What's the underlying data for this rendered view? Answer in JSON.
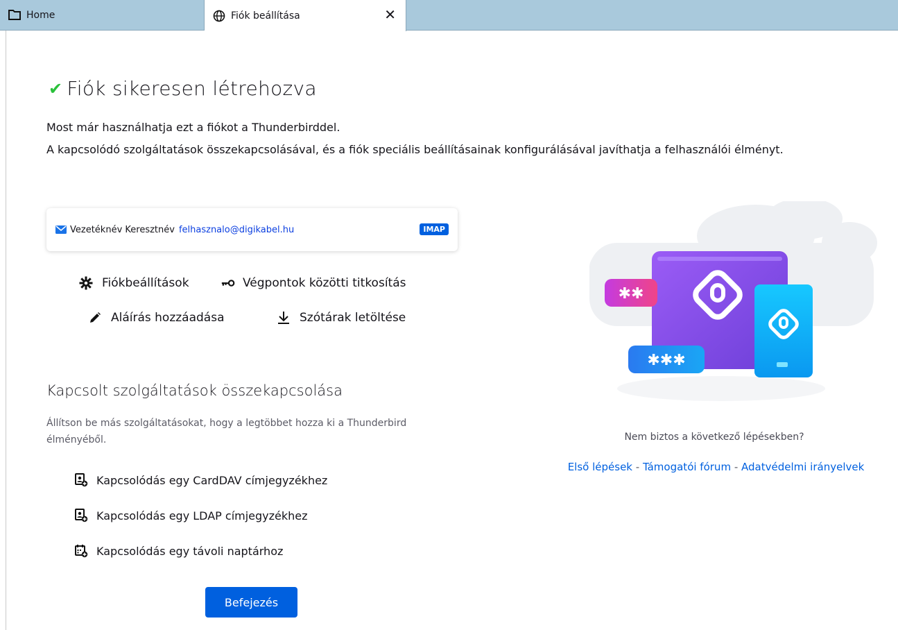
{
  "tabs": [
    {
      "label": "Home",
      "icon": "folder-icon"
    },
    {
      "label": "Fiók beállítása",
      "icon": "globe-icon",
      "close": "✕"
    }
  ],
  "header": {
    "check": "✔",
    "title": "Fiók sikeresen létrehozva",
    "line1": "Most már használhatja ezt a fiókot a Thunderbirddel.",
    "line2": "A kapcsolódó szolgáltatások összekapcsolásával, és a fiók speciális beállításainak konfigurálásával javíthatja a felhasználói élményt."
  },
  "account": {
    "name": "Vezetéknév Keresztnév",
    "email": "felhasznalo@digikabel.hu",
    "protocol": "IMAP"
  },
  "actions": {
    "settings": "Fiókbeállítások",
    "e2ee": "Végpontok közötti titkosítás",
    "signature": "Aláírás hozzáadása",
    "dictionaries": "Szótárak letöltése"
  },
  "services": {
    "heading": "Kapcsolt szolgáltatások összekapcsolása",
    "description": "Állítson be más szolgáltatásokat, hogy a legtöbbet hozza ki a Thunderbird élményéből.",
    "items": [
      {
        "label": "Kapcsolódás egy CardDAV címjegyzékhez",
        "icon": "address-book-add-icon"
      },
      {
        "label": "Kapcsolódás egy LDAP címjegyzékhez",
        "icon": "address-book-add-icon"
      },
      {
        "label": "Kapcsolódás egy távoli naptárhoz",
        "icon": "calendar-add-icon"
      }
    ]
  },
  "finish_button": "Befejezés",
  "help": {
    "question": "Nem biztos a következő lépésekben?",
    "link1": "Első lépések",
    "link2": "Támogatói fórum",
    "link3": "Adatvédelmi irányelvek",
    "separator": " - "
  },
  "illustration": {
    "mask_top": "✱✱",
    "mask_bottom": "✱✱✱"
  },
  "colors": {
    "accent": "#0060df",
    "success": "#2ac13b",
    "tabbar": "#a9c9dc"
  }
}
